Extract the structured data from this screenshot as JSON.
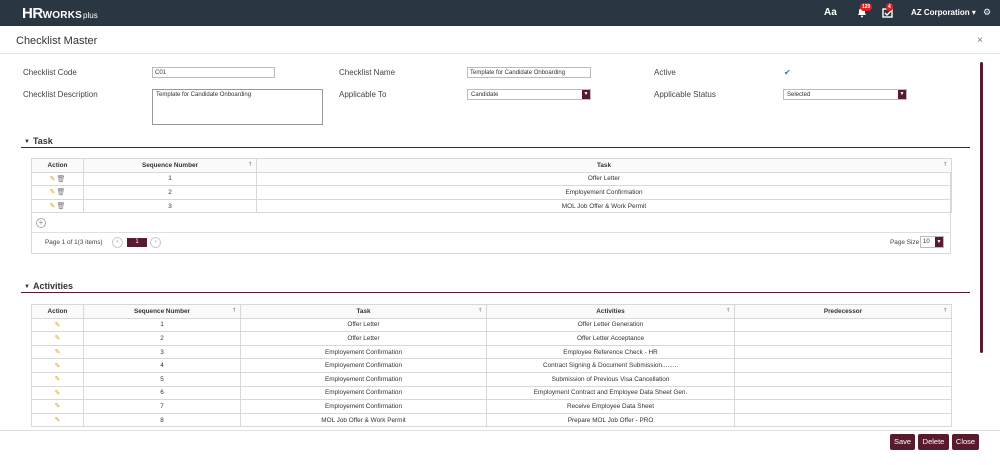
{
  "header": {
    "logo_hr": "HR",
    "logo_works": "WORKS",
    "logo_plus": "plus",
    "font_icon_label": "Aa",
    "notifications_count": "120",
    "tasks_count": "4",
    "company": "AZ Corporation ▾"
  },
  "page": {
    "title": "Checklist Master",
    "close": "×"
  },
  "form": {
    "code_label": "Checklist Code",
    "code_value": "C01",
    "name_label": "Checklist Name",
    "name_value": "Template for Candidate Onboarding",
    "active_label": "Active",
    "active_checked": true,
    "description_label": "Checklist Description",
    "description_value": "Template for Candidate Onboarding",
    "applicable_to_label": "Applicable To",
    "applicable_to_value": "Candidate",
    "applicable_status_label": "Applicable Status",
    "applicable_status_value": "Selected"
  },
  "task_section": {
    "heading": "Task",
    "columns": [
      "Action",
      "Sequence Number",
      "Task"
    ],
    "rows": [
      {
        "seq": "1",
        "task": "Offer Letter"
      },
      {
        "seq": "2",
        "task": "Employement Confirmation"
      },
      {
        "seq": "3",
        "task": "MOL Job Offer & Work Permit"
      }
    ],
    "pager_text": "Page 1 of 1(3 items)",
    "current_page": "1",
    "page_size_label": "Page Size",
    "page_size_value": "10"
  },
  "activities_section": {
    "heading": "Activities",
    "columns": [
      "Action",
      "Sequence Number",
      "Task",
      "Activities",
      "Predecessor"
    ],
    "rows": [
      {
        "seq": "1",
        "task": "Offer Letter",
        "activity": "Offer Letter Generation",
        "pred": ""
      },
      {
        "seq": "2",
        "task": "Offer Letter",
        "activity": "Offer Letter Acceptance",
        "pred": ""
      },
      {
        "seq": "3",
        "task": "Employement Confirmation",
        "activity": "Employee Reference Check - HR",
        "pred": ""
      },
      {
        "seq": "4",
        "task": "Employement Confirmation",
        "activity": "Contract Signing & Document Submission.........",
        "pred": ""
      },
      {
        "seq": "5",
        "task": "Employement Confirmation",
        "activity": "Submission of Previous Visa Cancellation",
        "pred": ""
      },
      {
        "seq": "6",
        "task": "Employement Confirmation",
        "activity": "Employment Contract and Employee Data Sheet Gen.",
        "pred": ""
      },
      {
        "seq": "7",
        "task": "Employement Confirmation",
        "activity": "Receive Employee Data Sheet",
        "pred": ""
      },
      {
        "seq": "8",
        "task": "MOL Job Offer & Work Permit",
        "activity": "Prepare MOL Job Offer - PRO",
        "pred": ""
      }
    ]
  },
  "footer": {
    "save": "Save",
    "delete": "Delete",
    "close": "Close"
  },
  "colors": {
    "topbar": "#2b3643",
    "accent": "#5a1a2e"
  }
}
